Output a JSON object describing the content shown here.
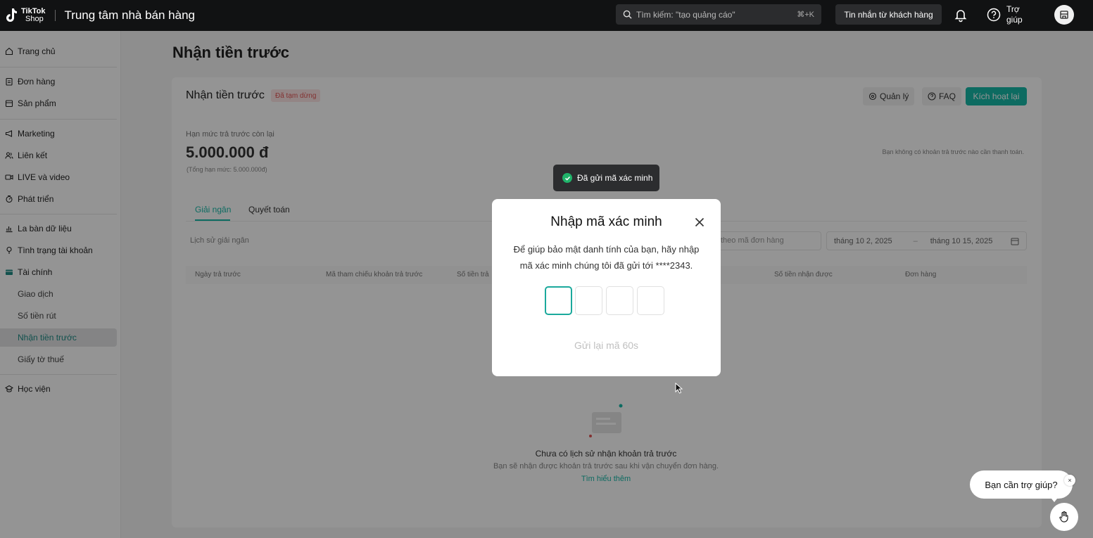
{
  "topbar": {
    "logo_line1": "TikTok",
    "logo_line2": "Shop",
    "app_title": "Trung tâm nhà bán hàng",
    "search_placeholder": "Tìm kiếm: \"tạo quảng cáo\"",
    "search_shortcut": "⌘+K",
    "messages_button": "Tin nhắn từ khách hàng",
    "help_line1": "Trợ",
    "help_line2": "giúp"
  },
  "sidebar": {
    "items": [
      {
        "label": "Trang chủ",
        "icon": "home-icon"
      },
      {
        "label": "Đơn hàng",
        "icon": "clipboard-icon"
      },
      {
        "label": "Sản phẩm",
        "icon": "box-icon"
      },
      {
        "label": "Marketing",
        "icon": "megaphone-icon"
      },
      {
        "label": "Liên kết",
        "icon": "users-icon"
      },
      {
        "label": "LIVE và video",
        "icon": "video-icon"
      },
      {
        "label": "Phát triển",
        "icon": "growth-icon"
      },
      {
        "label": "La bàn dữ liệu",
        "icon": "chart-icon"
      },
      {
        "label": "Tình trạng tài khoản",
        "icon": "shield-icon"
      },
      {
        "label": "Tài chính",
        "icon": "wallet-icon"
      },
      {
        "label": "Giao dịch"
      },
      {
        "label": "Số tiền rút"
      },
      {
        "label": "Nhận tiền trước"
      },
      {
        "label": "Giấy tờ thuế"
      },
      {
        "label": "Học viện",
        "icon": "academy-icon"
      }
    ]
  },
  "main": {
    "page_title": "Nhận tiền trước",
    "card_title": "Nhận tiền trước",
    "status_badge": "Đã tạm dừng",
    "manage_button": "Quản lý",
    "faq_button": "FAQ",
    "reactivate_button": "Kích hoạt lại",
    "limit_label": "Hạn mức trả trước còn lại",
    "limit_value": "5.000.000 đ",
    "limit_note": "(Tổng hạn mức: 5.000.000đ)",
    "pay_note": "Bạn không có khoản trả trước nào cần thanh toán.",
    "tabs": [
      "Giải ngân",
      "Quyết toán"
    ],
    "history_label": "Lịch sử giải ngân",
    "order_search_placeholder": "theo mã đơn hàng",
    "date_from": "tháng 10 2, 2025",
    "date_to": "tháng 10 15, 2025",
    "columns": [
      "Ngày trả trước",
      "Mã tham chiếu khoản trả trước",
      "Số tiền trả",
      "Số tiền nhận được",
      "Đơn hàng"
    ],
    "empty_title": "Chưa có lịch sử nhận khoản trả trước",
    "empty_sub": "Bạn sẽ nhận được khoản trả trước sau khi vận chuyển đơn hàng.",
    "empty_link": "Tìm hiểu thêm"
  },
  "toast": {
    "text": "Đã gửi mã xác minh"
  },
  "modal": {
    "title": "Nhập mã xác minh",
    "description": "Để giúp bảo mật danh tính của bạn, hãy nhập mã xác minh chúng tôi đã gửi tới ****2343.",
    "resend": "Gửi lại mã 60s"
  },
  "chat": {
    "bubble": "Bạn cần trợ giúp?",
    "close": "×"
  },
  "colors": {
    "accent": "#18b8a8",
    "topbar": "#111213",
    "success": "#20b36a"
  }
}
